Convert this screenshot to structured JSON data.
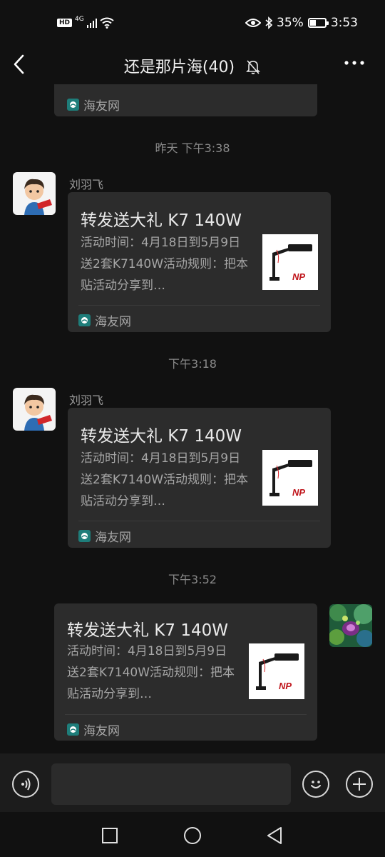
{
  "status_bar": {
    "network": "4G",
    "battery": "35%",
    "battery_level": 0.35,
    "time": "3:53"
  },
  "header": {
    "title": "还是那片海(40)"
  },
  "messages": [
    {
      "type": "card-fragment",
      "source": "海友网"
    },
    {
      "type": "timestamp",
      "text": "昨天 下午3:38"
    },
    {
      "type": "card",
      "sender": "刘羽飞",
      "title": "转发送大礼 K7 140W",
      "description": "活动时间：4月18日到5月9日送2套K7140W活动规则：把本贴活动分享到…",
      "thumb_text": "NP",
      "source": "海友网"
    },
    {
      "type": "timestamp",
      "text": "下午3:18"
    },
    {
      "type": "card",
      "sender": "刘羽飞",
      "title": "转发送大礼 K7 140W",
      "description": "活动时间：4月18日到5月9日送2套K7140W活动规则：把本贴活动分享到…",
      "thumb_text": "NP",
      "source": "海友网"
    },
    {
      "type": "timestamp",
      "text": "下午3:52"
    },
    {
      "type": "card",
      "title": "转发送大礼 K7 140W",
      "description": "活动时间：4月18日到5月9日送2套K7140W活动规则：把本贴活动分享到…",
      "thumb_text": "NP",
      "source": "海友网"
    }
  ],
  "input": {
    "value": ""
  },
  "icons": [
    "back-icon",
    "mute-bell-icon",
    "more-icon",
    "voice-icon",
    "emoji-icon",
    "plus-icon",
    "nav-square-icon",
    "nav-circle-icon",
    "nav-back-icon"
  ],
  "colors": {
    "background": "#111111",
    "card": "#2c2c2c",
    "source_icon": "#1e7d7a",
    "thumb_brand": "#c0161c"
  }
}
